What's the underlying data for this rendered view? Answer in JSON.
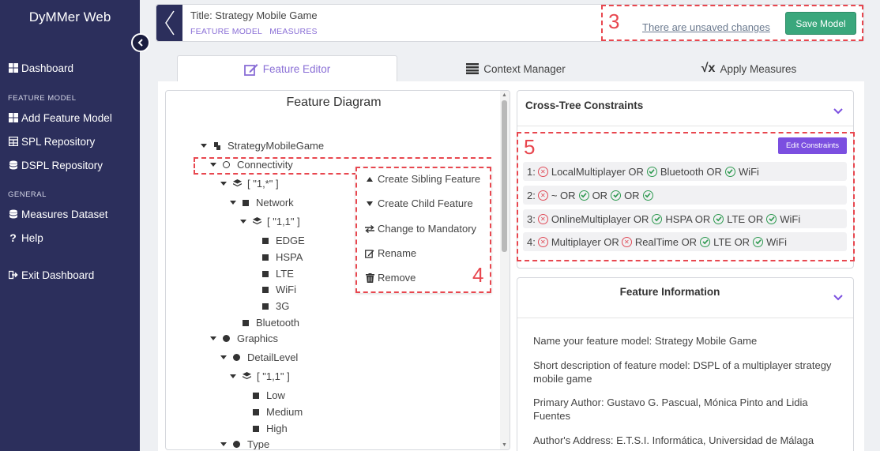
{
  "sidebar": {
    "brand": "DyMMer Web",
    "items": [
      {
        "label": "Dashboard",
        "icon": "grid-icon"
      },
      {
        "header": "FEATURE MODEL"
      },
      {
        "label": "Add Feature Model",
        "icon": "grid-icon"
      },
      {
        "label": "SPL Repository",
        "icon": "table-icon"
      },
      {
        "label": "DSPL Repository",
        "icon": "database-icon"
      },
      {
        "header": "GENERAL"
      },
      {
        "label": "Measures Dataset",
        "icon": "database-icon"
      },
      {
        "label": "Help",
        "icon": "question-icon"
      },
      {
        "label": "Exit Dashboard",
        "icon": "sign-out-icon"
      }
    ]
  },
  "topbar": {
    "title": "Title: Strategy Mobile Game",
    "crumbs": [
      "FEATURE MODEL",
      "MEASURES"
    ],
    "unsaved": "There are unsaved changes",
    "save_label": "Save Model",
    "annotation": "3"
  },
  "tabs": [
    {
      "label": "Feature Editor",
      "icon": "edit-icon",
      "active": true
    },
    {
      "label": "Context Manager",
      "icon": "list-icon",
      "active": false
    },
    {
      "label": "Apply Measures",
      "icon": "sqrt-x-icon",
      "active": false
    }
  ],
  "diagram": {
    "title": "Feature Diagram",
    "nodes": {
      "root": "StrategyMobileGame",
      "connectivity": "Connectivity",
      "group1": "[ \"1,*\" ]",
      "network": "Network",
      "group2": "[ \"1,1\" ]",
      "edge": "EDGE",
      "hspa": "HSPA",
      "lte": "LTE",
      "wifi": "WiFi",
      "g3": "3G",
      "bluetooth": "Bluetooth",
      "graphics": "Graphics",
      "detail": "DetailLevel",
      "group3": "[ \"1,1\" ]",
      "low": "Low",
      "medium": "Medium",
      "high": "High",
      "type": "Type"
    }
  },
  "context_menu": {
    "annotation": "4",
    "items": [
      {
        "label": "Create Sibling Feature",
        "icon": "caret-up-icon"
      },
      {
        "label": "Create Child Feature",
        "icon": "caret-down-icon"
      },
      {
        "label": "Change to Mandatory",
        "icon": "exchange-icon"
      },
      {
        "label": "Rename",
        "icon": "edit-icon"
      },
      {
        "label": "Remove",
        "icon": "trash-icon"
      }
    ]
  },
  "cross_tree": {
    "title": "Cross-Tree Constraints",
    "annotation": "5",
    "edit_label": "Edit Constraints",
    "rows": [
      {
        "index": "1:",
        "parts": [
          {
            "status": "bad",
            "text": "LocalMultiplayer OR"
          },
          {
            "status": "good",
            "text": "Bluetooth OR"
          },
          {
            "status": "good",
            "text": "WiFi"
          }
        ]
      },
      {
        "index": "2:",
        "parts": [
          {
            "status": "bad",
            "text": "~ OR"
          },
          {
            "status": "good",
            "text": "OR"
          },
          {
            "status": "good",
            "text": "OR"
          },
          {
            "status": "good",
            "text": ""
          }
        ]
      },
      {
        "index": "3:",
        "parts": [
          {
            "status": "bad",
            "text": "OnlineMultiplayer OR"
          },
          {
            "status": "good",
            "text": "HSPA OR"
          },
          {
            "status": "good",
            "text": "LTE OR"
          },
          {
            "status": "good",
            "text": "WiFi"
          }
        ]
      },
      {
        "index": "4:",
        "parts": [
          {
            "status": "bad",
            "text": "Multiplayer OR"
          },
          {
            "status": "bad",
            "text": "RealTime OR"
          },
          {
            "status": "good",
            "text": "LTE OR"
          },
          {
            "status": "good",
            "text": "WiFi"
          }
        ]
      }
    ]
  },
  "feature_info": {
    "title": "Feature Information",
    "lines": [
      "Name your feature model: Strategy Mobile Game",
      "Short description of feature model: DSPL of a multiplayer strategy mobile game",
      "Primary Author: Gustavo G. Pascual, Mónica Pinto and Lidia Fuentes",
      "Author's Address: E.T.S.I. Informática, Universidad de Málaga"
    ]
  },
  "colors": {
    "sidebar": "#2c2f5c",
    "accent": "#8a6fd6",
    "save": "#3aa77c",
    "annotation": "#e8474f",
    "edit_button": "#7b4fe0"
  }
}
